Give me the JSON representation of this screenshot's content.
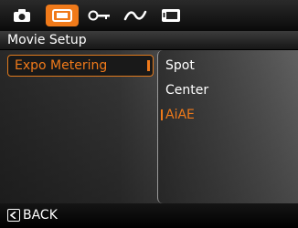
{
  "tabs": [
    {
      "name": "camera-icon",
      "active": false
    },
    {
      "name": "movie-icon",
      "active": true
    },
    {
      "name": "playback-key-icon",
      "active": false
    },
    {
      "name": "wave-icon",
      "active": false
    },
    {
      "name": "display-icon",
      "active": false
    }
  ],
  "header": {
    "title": "Movie Setup"
  },
  "menu": {
    "selected_item": "Expo Metering"
  },
  "submenu": {
    "options": [
      "Spot",
      "Center",
      "AiAE"
    ],
    "selected": "AiAE"
  },
  "footer": {
    "back_label": "BACK"
  },
  "colors": {
    "accent": "#f07a1a",
    "text": "#ffffff",
    "background": "#000000"
  }
}
